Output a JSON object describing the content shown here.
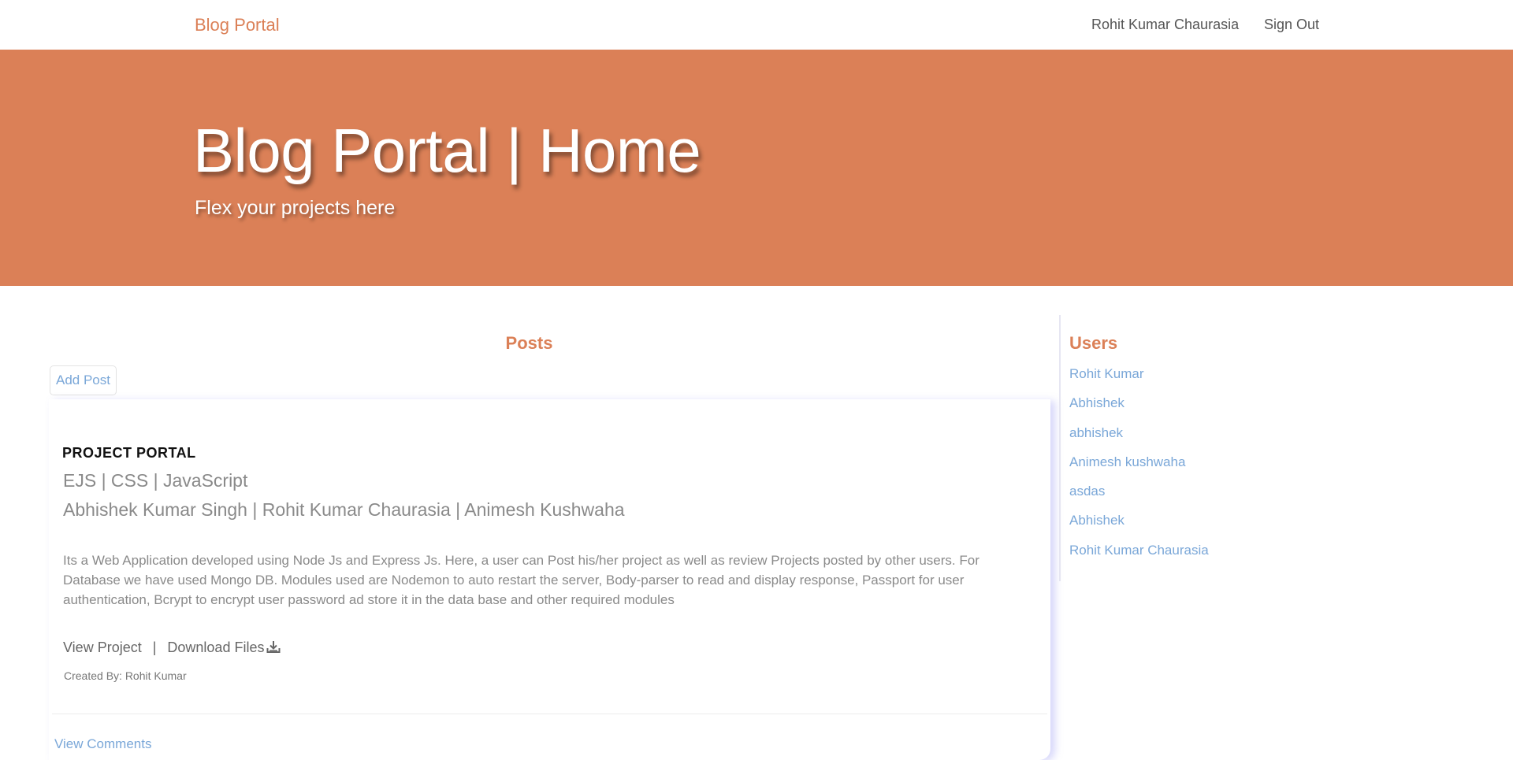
{
  "navbar": {
    "brand": "Blog Portal",
    "user_name": "Rohit Kumar Chaurasia",
    "sign_out": "Sign Out"
  },
  "hero": {
    "title": "Blog Portal | Home",
    "subtitle": "Flex your projects here"
  },
  "posts": {
    "heading": "Posts",
    "add_post_label": "Add Post",
    "items": [
      {
        "title": "PROJECT PORTAL",
        "tech": "EJS | CSS | JavaScript",
        "authors": "Abhishek Kumar Singh | Rohit Kumar Chaurasia | Animesh Kushwaha",
        "description": "Its a Web Application developed using Node Js and Express Js. Here, a user can Post his/her project as well as review Projects posted by other users. For Database we have used Mongo DB. Modules used are Nodemon to auto restart the server, Body-parser to read and display response, Passport for user authentication, Bcrypt to encrypt user password ad store it in the data base and other required modules",
        "view_project": "View Project",
        "separator": "|",
        "download_files": "Download Files",
        "download_icon": "download-icon",
        "created_by": "Created By: Rohit Kumar",
        "view_comments": "View Comments"
      }
    ]
  },
  "users": {
    "heading": "Users",
    "list": [
      "Rohit Kumar",
      "Abhishek",
      "abhishek",
      "Animesh kushwaha",
      "asdas",
      "Abhishek",
      "Rohit Kumar Chaurasia"
    ]
  },
  "colors": {
    "accent": "#db8057",
    "link": "#7aa7d8",
    "muted_text": "#8a8a8a"
  }
}
